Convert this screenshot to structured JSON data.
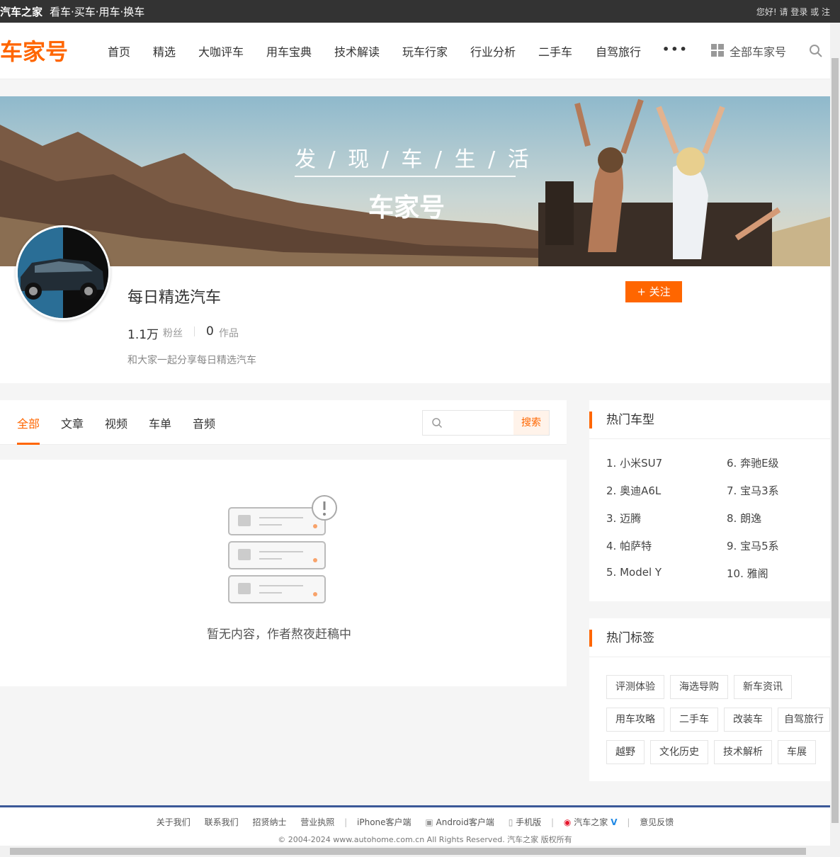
{
  "topbar": {
    "brand": "汽车之家",
    "slogan": "看车·买车·用车·换车",
    "login_text": "您好! 请 登录 或 注"
  },
  "nav": {
    "logo": "车家号",
    "items": [
      "首页",
      "精选",
      "大咖评车",
      "用车宝典",
      "技术解读",
      "玩车行家",
      "行业分析",
      "二手车",
      "自驾旅行"
    ],
    "more": "•••",
    "all_label": "全部车家号"
  },
  "banner": {
    "title": "发 / 现 / 车 / 生 / 活",
    "logo": "车家号"
  },
  "profile": {
    "name": "每日精选汽车",
    "follow_label": "+ 关注",
    "fans_count": "1.1万",
    "fans_label": "粉丝",
    "works_count": "0",
    "works_label": "作品",
    "description": "和大家一起分享每日精选汽车"
  },
  "tabs": {
    "items": [
      "全部",
      "文章",
      "视频",
      "车单",
      "音频"
    ],
    "active": "全部",
    "search_button": "搜索",
    "search_placeholder": ""
  },
  "content": {
    "empty_text": "暂无内容，作者熬夜赶稿中"
  },
  "hot_models": {
    "title": "热门车型",
    "items": [
      "1. 小米SU7",
      "2. 奥迪A6L",
      "3. 迈腾",
      "4. 帕萨特",
      "5. Model Y",
      "6. 奔驰E级",
      "7. 宝马3系",
      "8. 朗逸",
      "9. 宝马5系",
      "10. 雅阁"
    ]
  },
  "hot_tags": {
    "title": "热门标签",
    "items": [
      "评测体验",
      "海选导购",
      "新车资讯",
      "用车攻略",
      "二手车",
      "改装车",
      "自驾旅行",
      "越野",
      "文化历史",
      "技术解析",
      "车展"
    ]
  },
  "footer": {
    "links": [
      "关于我们",
      "联系我们",
      "招贤纳士",
      "营业执照",
      "iPhone客户端",
      "Android客户端",
      "手机版",
      "汽车之家",
      "意见反馈"
    ],
    "copyright": "© 2004-2024 www.autohome.com.cn All Rights Reserved. 汽车之家 版权所有"
  },
  "colors": {
    "accent": "#ff6600",
    "topbar": "#333333",
    "footer_border": "#3b5998"
  }
}
